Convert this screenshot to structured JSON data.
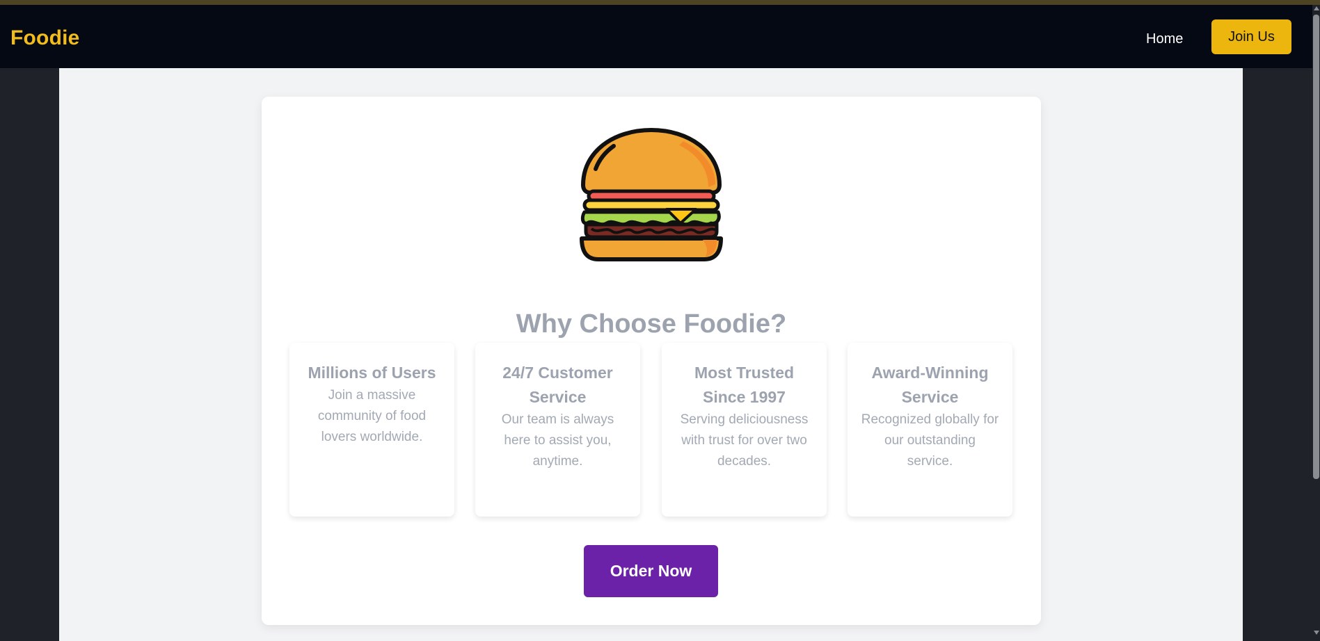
{
  "navbar": {
    "brand": "Foodie",
    "links": {
      "home": "Home"
    },
    "join_label": "Join Us"
  },
  "hero": {
    "image_icon": "burger-icon",
    "headline": "Why Choose Foodie?"
  },
  "features": [
    {
      "title": "Millions of Users",
      "description": "Join a massive community of food lovers worldwide."
    },
    {
      "title": "24/7 Customer Service",
      "description": "Our team is always here to assist you, anytime."
    },
    {
      "title": "Most Trusted Since 1997",
      "description": "Serving deliciousness with trust for over two decades."
    },
    {
      "title": "Award-Winning Service",
      "description": "Recognized globally for our outstanding service."
    }
  ],
  "cta": {
    "order_label": "Order Now"
  },
  "colors": {
    "brand_yellow": "#f2bd1b",
    "button_yellow": "#edb60e",
    "navbar_bg": "#040914",
    "cta_purple": "#6b21a8",
    "muted_text": "#9ca3af"
  }
}
